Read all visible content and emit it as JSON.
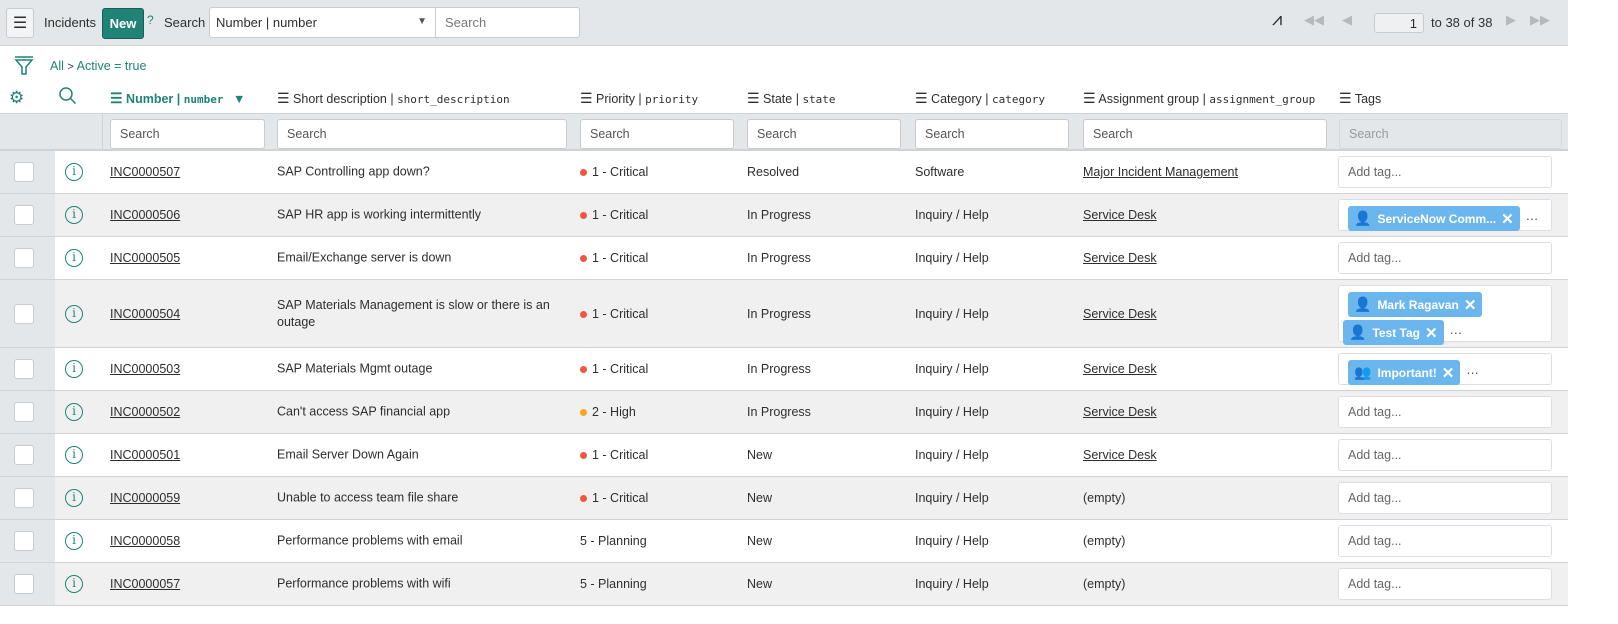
{
  "header": {
    "title": "Incidents",
    "new_label": "New",
    "help": "?",
    "search_label": "Search",
    "search_field": "Number | number",
    "search_placeholder": "Search",
    "page": "1",
    "range": "to 38 of 38"
  },
  "breadcrumb": {
    "all": "All",
    "sep": ">",
    "filter": "Active = true"
  },
  "columns": [
    {
      "label": "Number",
      "field": "number"
    },
    {
      "label": "Short description",
      "field": "short_description"
    },
    {
      "label": "Priority",
      "field": "priority"
    },
    {
      "label": "State",
      "field": "state"
    },
    {
      "label": "Category",
      "field": "category"
    },
    {
      "label": "Assignment group",
      "field": "assignment_group"
    },
    {
      "label": "Tags",
      "field": ""
    }
  ],
  "column_search_placeholder": "Search",
  "add_tag_placeholder": "Add tag...",
  "colors": {
    "accent": "#1f8476",
    "critical": "#f0573f",
    "high": "#f5a623",
    "tag": "#6cb6ee"
  },
  "rows": [
    {
      "number": "INC0000507",
      "desc": "SAP Controlling app down?",
      "priority": "1 - Critical",
      "pcolor": "critical",
      "state": "Resolved",
      "category": "Software",
      "group": "Major Incident Management",
      "tags": []
    },
    {
      "number": "INC0000506",
      "desc": "SAP HR app is working intermittently",
      "priority": "1 - Critical",
      "pcolor": "critical",
      "state": "In Progress",
      "category": "Inquiry / Help",
      "group": "Service Desk",
      "tags": [
        {
          "label": "ServiceNow Comm...",
          "icon": "user-icon"
        }
      ]
    },
    {
      "number": "INC0000505",
      "desc": "Email/Exchange server is down",
      "priority": "1 - Critical",
      "pcolor": "critical",
      "state": "In Progress",
      "category": "Inquiry / Help",
      "group": "Service Desk",
      "tags": []
    },
    {
      "number": "INC0000504",
      "desc": "SAP Materials Management is slow or there is an outage",
      "priority": "1 - Critical",
      "pcolor": "critical",
      "state": "In Progress",
      "category": "Inquiry / Help",
      "group": "Service Desk",
      "tags": [
        {
          "label": "Mark Ragavan",
          "icon": "user-icon"
        },
        {
          "label": "Test Tag",
          "icon": "user-icon"
        }
      ]
    },
    {
      "number": "INC0000503",
      "desc": "SAP Materials Mgmt outage",
      "priority": "1 - Critical",
      "pcolor": "critical",
      "state": "In Progress",
      "category": "Inquiry / Help",
      "group": "Service Desk",
      "tags": [
        {
          "label": "Important!",
          "icon": "group-icon"
        }
      ]
    },
    {
      "number": "INC0000502",
      "desc": "Can't access SAP financial app",
      "priority": "2 - High",
      "pcolor": "high",
      "state": "In Progress",
      "category": "Inquiry / Help",
      "group": "Service Desk",
      "tags": []
    },
    {
      "number": "INC0000501",
      "desc": "Email Server Down Again",
      "priority": "1 - Critical",
      "pcolor": "critical",
      "state": "New",
      "category": "Inquiry / Help",
      "group": "Service Desk",
      "tags": []
    },
    {
      "number": "INC0000059",
      "desc": "Unable to access team file share",
      "priority": "1 - Critical",
      "pcolor": "critical",
      "state": "New",
      "category": "Inquiry / Help",
      "group": "(empty)",
      "tags": []
    },
    {
      "number": "INC0000058",
      "desc": "Performance problems with email",
      "priority": "5 - Planning",
      "pcolor": "",
      "state": "New",
      "category": "Inquiry / Help",
      "group": "(empty)",
      "tags": []
    },
    {
      "number": "INC0000057",
      "desc": "Performance problems with wifi",
      "priority": "5 - Planning",
      "pcolor": "",
      "state": "New",
      "category": "Inquiry / Help",
      "group": "(empty)",
      "tags": []
    }
  ]
}
